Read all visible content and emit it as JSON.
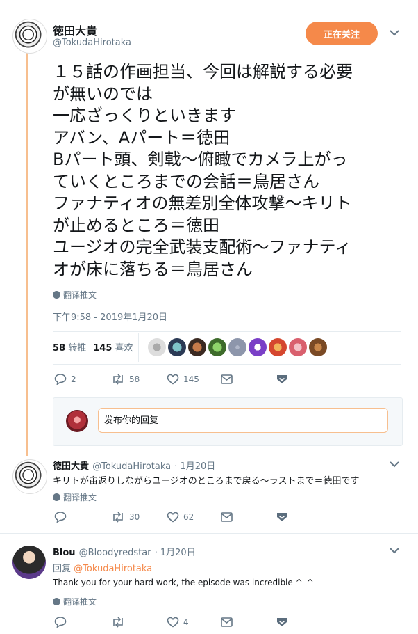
{
  "main_tweet": {
    "author_name": "徳田大貴",
    "author_handle": "@TokudaHirotaka",
    "follow_label": "正在关注",
    "lines": [
      "１５話の作画担当、今回は解説する必要",
      "が無いのでは",
      "一応ざっくりといきます",
      "アバン、Aパート＝徳田",
      "Bパート頭、剣戟〜俯瞰でカメラ上がっ",
      "ていくところまでの会話＝鳥居さん",
      "ファナティオの無差別全体攻撃〜キリト",
      "が止めるところ＝徳田",
      "ユージオの完全武装支配術〜ファナティ",
      "オが床に落ちる＝鳥居さん"
    ],
    "translate_label": "翻译推文",
    "timestamp": "下午9:58 - 2019年1月20日",
    "retweets_count": "58",
    "retweets_label": "转推",
    "likes_count": "145",
    "likes_label": "喜欢",
    "replies": "2",
    "retweets": "58",
    "likes": "145",
    "reply_placeholder": "发布你的回复"
  },
  "reply1": {
    "author_name": "徳田大貴",
    "author_handle": "@TokudaHirotaka",
    "date": "· 1月20日",
    "text": "キリトが宙返りしながらユージオのところまで戻る〜ラストまで＝徳田です",
    "translate_label": "翻译推文",
    "replies": "",
    "retweets": "30",
    "likes": "62"
  },
  "reply2": {
    "author_name": "Blou",
    "author_handle": "@Bloodyredstar",
    "date": "· 1月20日",
    "reply_to_prefix": "回复",
    "reply_to_handle": "@TokudaHirotaka",
    "text": "Thank you for your hard work, the episode was incredible ^_^",
    "translate_label": "翻译推文",
    "replies": "",
    "retweets": "",
    "likes": "4"
  },
  "colors": {
    "accent": "#f5894a",
    "thread_line": "#f7bf8f",
    "muted": "#657786"
  },
  "icons": [
    "chevron-down-icon",
    "globe-icon",
    "reply-icon",
    "retweet-icon",
    "like-icon",
    "message-icon",
    "bookmark-icon"
  ]
}
